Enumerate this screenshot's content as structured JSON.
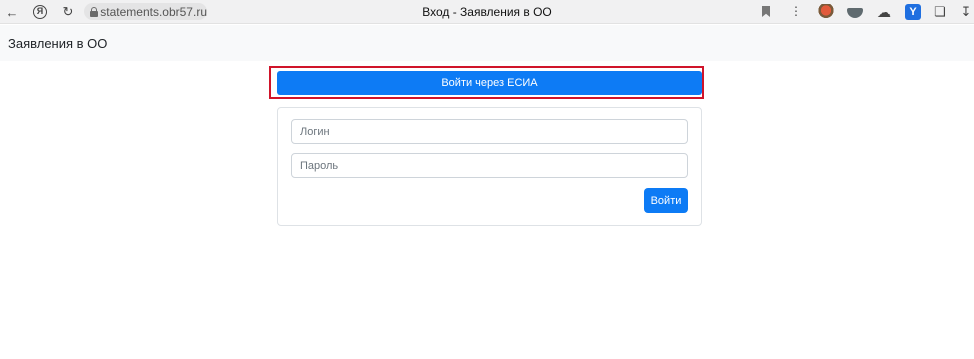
{
  "browser": {
    "address": "statements.obr57.ru",
    "tab_title": "Вход - Заявления в ОО",
    "ya_label": "Я",
    "ext_4_label": "Y"
  },
  "app": {
    "brand": "Заявления в ОО"
  },
  "auth": {
    "esia_button_label": "Войти через ЕСИА",
    "login_placeholder": "Логин",
    "password_placeholder": "Пароль",
    "submit_label": "Войти"
  },
  "colors": {
    "primary": "#0d7bf5",
    "highlight_frame": "#d0142a"
  }
}
